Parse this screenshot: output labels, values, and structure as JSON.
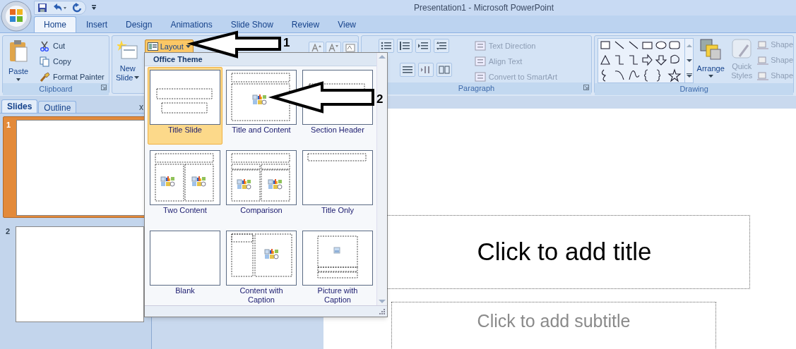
{
  "window": {
    "title": "Presentation1 - Microsoft PowerPoint"
  },
  "tabs": [
    {
      "label": "Home",
      "selected": true
    },
    {
      "label": "Insert",
      "selected": false
    },
    {
      "label": "Design",
      "selected": false
    },
    {
      "label": "Animations",
      "selected": false
    },
    {
      "label": "Slide Show",
      "selected": false
    },
    {
      "label": "Review",
      "selected": false
    },
    {
      "label": "View",
      "selected": false
    }
  ],
  "clipboard": {
    "label": "Clipboard",
    "paste": "Paste",
    "commands": [
      "Cut",
      "Copy",
      "Format Painter"
    ]
  },
  "slides_group": {
    "new_slide": "New",
    "new_slide_2": "Slide",
    "layout": {
      "label": "Layout",
      "pressed": true
    }
  },
  "paragraph": {
    "label": "Paragraph",
    "commands": [
      {
        "label": "Text Direction",
        "disabled": true
      },
      {
        "label": "Align Text",
        "disabled": true
      },
      {
        "label": "Convert to SmartArt",
        "disabled": true
      }
    ]
  },
  "drawing": {
    "label": "Drawing",
    "arrange": "Arrange",
    "quick_styles": "Quick",
    "quick_styles_2": "Styles",
    "shape_commands": [
      "Shape",
      "Shape",
      "Shape"
    ]
  },
  "pane_tabs": [
    {
      "label": "Slides",
      "selected": true
    },
    {
      "label": "Outline",
      "selected": false
    }
  ],
  "pane_close": "x",
  "thumbnails": [
    {
      "number": "1",
      "selected": true
    },
    {
      "number": "2",
      "selected": false
    }
  ],
  "layout_gallery": {
    "heading": "Office Theme",
    "layouts": [
      {
        "label": "Title Slide",
        "kind": "title",
        "selected": true
      },
      {
        "label": "Title and Content",
        "kind": "title_content",
        "selected": false
      },
      {
        "label": "Section Header",
        "kind": "section",
        "selected": false
      },
      {
        "label": "Two Content",
        "kind": "two_content",
        "selected": false
      },
      {
        "label": "Comparison",
        "kind": "comparison",
        "selected": false
      },
      {
        "label": "Title Only",
        "kind": "title_only",
        "selected": false
      },
      {
        "label": "Blank",
        "kind": "blank",
        "selected": false
      },
      {
        "label": "Content with Caption",
        "kind": "content_caption",
        "selected": false
      },
      {
        "label": "Picture with Caption",
        "kind": "picture_caption",
        "selected": false
      }
    ]
  },
  "slide": {
    "title_placeholder": "Click to add title",
    "subtitle_placeholder": "Click to add subtitle"
  },
  "annotations": [
    {
      "label": "1"
    },
    {
      "label": "2"
    }
  ]
}
